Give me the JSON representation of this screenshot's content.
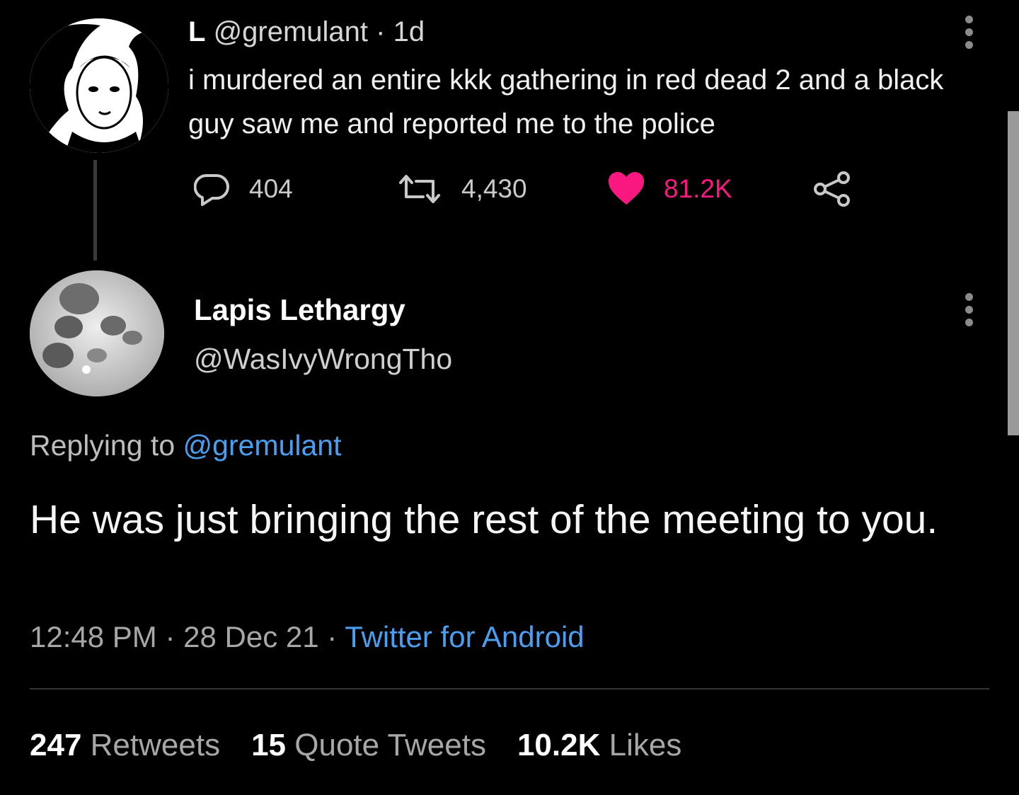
{
  "parent_tweet": {
    "name": "L",
    "handle": "@gremulant",
    "separator": "·",
    "time": "1d",
    "text": "i murdered an entire kkk gathering in red dead 2 and a black guy saw me and reported me to the police",
    "replies": "404",
    "retweets": "4,430",
    "likes": "81.2K",
    "avatar_icon": "portrait-avatar"
  },
  "reply_tweet": {
    "name": "Lapis Lethargy",
    "handle": "@WasIvyWrongTho",
    "replying_prefix": "Replying to",
    "replying_to": "@gremulant",
    "text": "He was just bringing the rest of the meeting to you.",
    "time": "12:48 PM",
    "date": "28 Dec 21",
    "source": "Twitter for Android",
    "separator": "·",
    "avatar_icon": "moon-avatar"
  },
  "stats": {
    "retweets_count": "247",
    "retweets_label": "Retweets",
    "quotes_count": "15",
    "quotes_label": "Quote Tweets",
    "likes_count": "10.2K",
    "likes_label": "Likes"
  },
  "colors": {
    "background": "#000000",
    "like": "#f91880",
    "link": "#4b9ff0"
  }
}
